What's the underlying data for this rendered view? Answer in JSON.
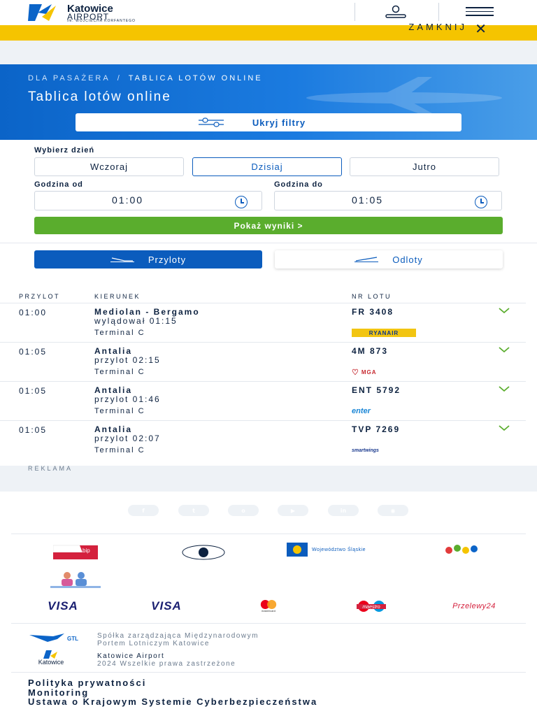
{
  "header": {
    "logo_name": "Katowice",
    "logo_sub": "AIRPORT",
    "logo_tag": "im. WOJCIECHA KORFANTEGO",
    "user_icon": "user-icon",
    "menu_icon": "hamburger-icon"
  },
  "banner": {
    "close_label": "ZAMKNIJ",
    "close_icon": "close-icon",
    "color": "#f5c400"
  },
  "hero": {
    "breadcrumb": [
      "DLA PASAŻERA",
      "/",
      "TABLICA LOTÓW ONLINE"
    ],
    "title": "Tablica lotów online",
    "filters_button": "Ukryj filtry",
    "gradient_start": "#0b64c8"
  },
  "filters": {
    "day_label": "Wybierz dzień",
    "days": [
      "Wczoraj",
      "Dzisiaj",
      "Jutro"
    ],
    "selected_day": "Dzisiaj",
    "time_from_label": "Godzina od",
    "time_from": "01:00",
    "time_to_label": "Godzina do",
    "time_to": "01:05",
    "show_button": "Pokaż wyniki  >",
    "show_color": "#5aad2d"
  },
  "tabs": {
    "arrivals": "Przyloty",
    "departures": "Odloty",
    "active": "arrivals"
  },
  "table": {
    "headers": {
      "time": "PRZYLOT",
      "destination": "KIERUNEK",
      "flight": "NR LOTU"
    },
    "rows": [
      {
        "time": "01:00",
        "dest": "Mediolan - Bergamo",
        "status": "wylądował 01:15",
        "terminal": "Terminal C",
        "flight": "FR 3408",
        "airline": "RYANAIR"
      },
      {
        "time": "01:05",
        "dest": "Antalia",
        "status": "przylot 02:15",
        "terminal": "Terminal C",
        "flight": "4M 873",
        "airline": "MGA"
      },
      {
        "time": "01:05",
        "dest": "Antalia",
        "status": "przylot 01:46",
        "terminal": "Terminal C",
        "flight": "ENT 5792",
        "airline": "enter"
      },
      {
        "time": "01:05",
        "dest": "Antalia",
        "status": "przylot 02:07",
        "terminal": "Terminal C",
        "flight": "TVP 7269",
        "airline": "smartwings"
      }
    ]
  },
  "ad_label": "REKLAMA",
  "socials": [
    "f",
    "t",
    "o",
    "▶",
    "in",
    "◉"
  ],
  "partners": [
    "bip",
    "Województwo Śląskie"
  ],
  "payments": [
    "VISA",
    "VISA",
    "mastercard",
    "maestro",
    "Przelewy24"
  ],
  "company": {
    "gtl_line1": "Spółka zarządzająca Międzynarodowym",
    "gtl_line2": "Portem Lotniczym Katowice",
    "ka_line1": "Katowice Airport",
    "ka_line2": "2024 Wszelkie prawa zastrzeżone"
  },
  "footer_links": [
    "Polityka prywatności",
    "Monitoring",
    "Ustawa o Krajowym Systemie Cyberbezpieczeństwa"
  ]
}
